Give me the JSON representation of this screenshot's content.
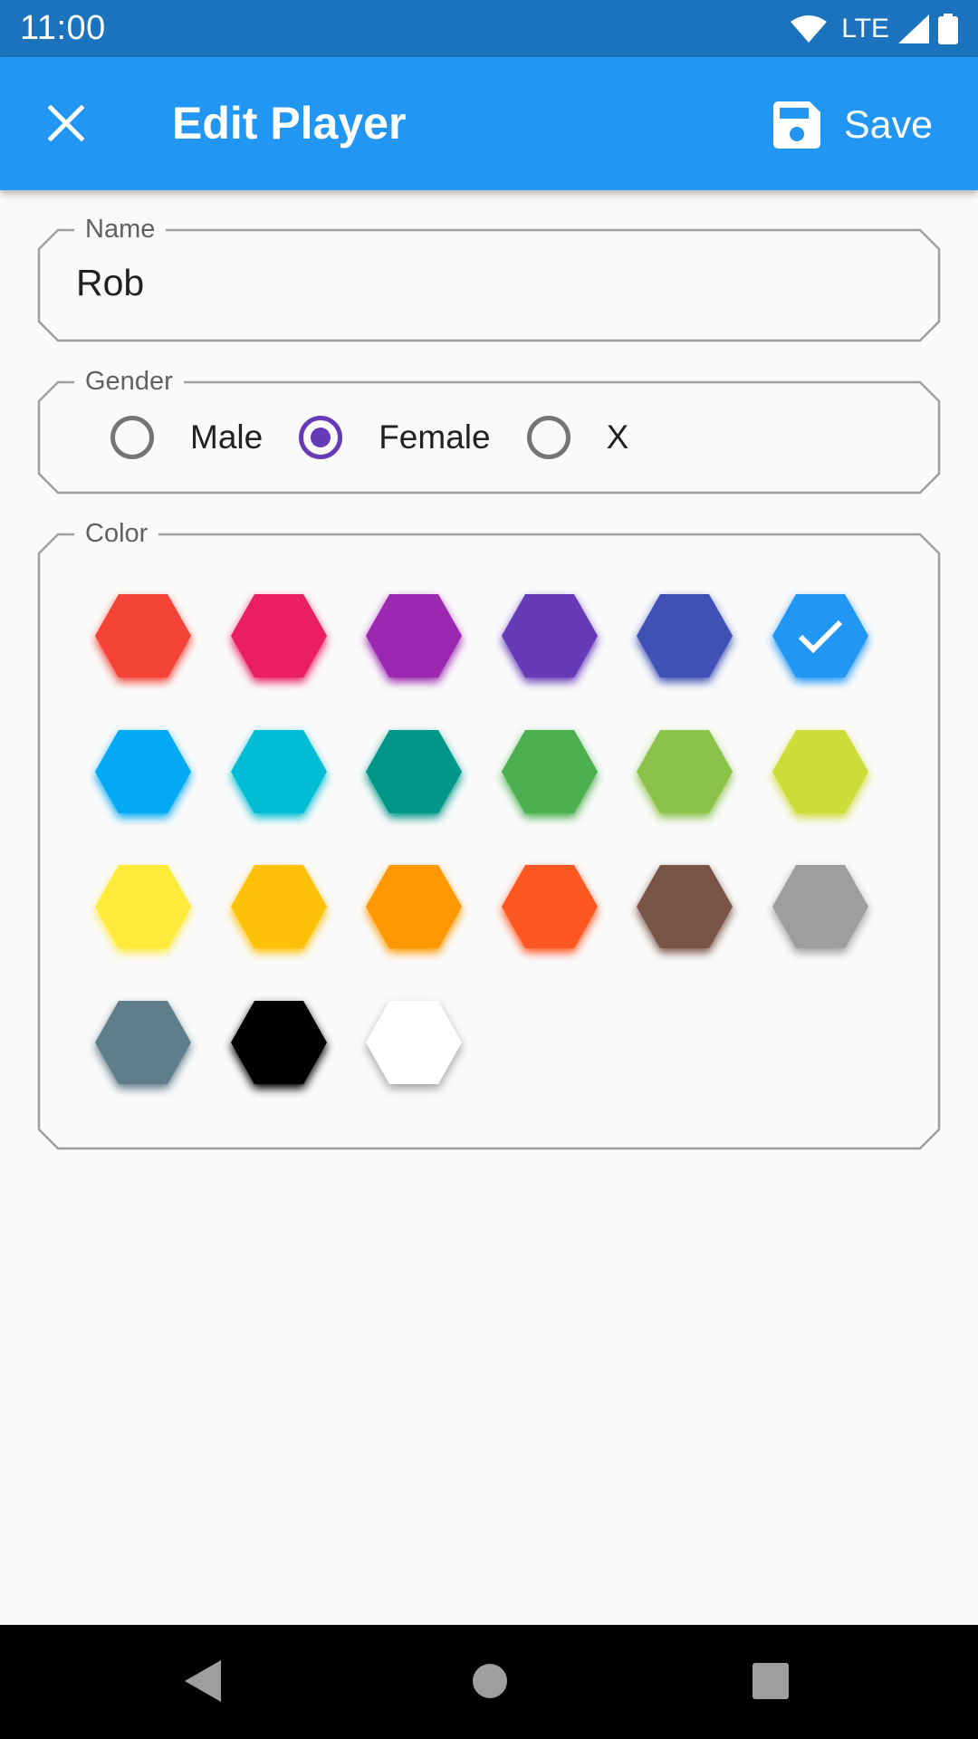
{
  "status": {
    "time": "11:00",
    "network": "LTE"
  },
  "appbar": {
    "title": "Edit Player",
    "save_label": "Save",
    "color": "#2196f3"
  },
  "form": {
    "name": {
      "label": "Name",
      "value": "Rob"
    },
    "gender": {
      "label": "Gender",
      "options": [
        {
          "label": "Male",
          "selected": false
        },
        {
          "label": "Female",
          "selected": true
        },
        {
          "label": "X",
          "selected": false
        }
      ],
      "accent": "#673ab7"
    },
    "color": {
      "label": "Color",
      "selected": "#2196f3",
      "swatches": [
        "#f44336",
        "#e91e63",
        "#9c27b0",
        "#673ab7",
        "#3f51b5",
        "#2196f3",
        "#03a9f4",
        "#00bcd4",
        "#009688",
        "#4caf50",
        "#8bc34a",
        "#cddc39",
        "#ffeb3b",
        "#ffc107",
        "#ff9800",
        "#ff5722",
        "#795548",
        "#9e9e9e",
        "#607d8b",
        "#000000",
        "#ffffff"
      ]
    }
  },
  "icons": {
    "close": "close-icon",
    "save": "floppy-disk-icon",
    "back": "nav-back-icon",
    "home": "nav-home-icon",
    "recents": "nav-recents-icon"
  }
}
